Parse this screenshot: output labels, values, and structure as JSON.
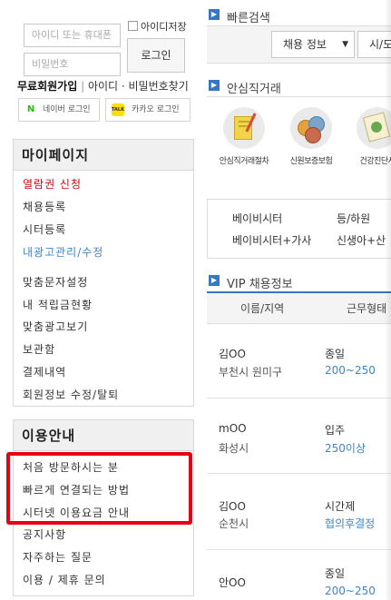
{
  "login": {
    "id_placeholder": "아이디 또는 휴대폰",
    "pw_placeholder": "비밀번호",
    "save_id_label": "아이디저장",
    "login_button": "로그인",
    "signup_link": "무료회원가입",
    "separator": "|",
    "find_link": "아이디 · 비밀번호찾기",
    "naver_label": "네이버 로그인",
    "kakao_label": "카카오 로그인",
    "naver_icon_text": "N",
    "kakao_icon_text": "TALK"
  },
  "mypage": {
    "title": "마이페이지",
    "items": [
      "열람권 신청",
      "채용등록",
      "시터등록",
      "내광고관리/수정",
      "맞춤문자설정",
      "내 적립금현황",
      "맞춤광고보기",
      "보관함",
      "결제내역",
      "회원정보 수정/탈퇴"
    ]
  },
  "guide": {
    "title": "이용안내",
    "items": [
      "처음 방문하시는 분",
      "빠르게 연결되는 방법",
      "시터넷 이용요금 안내",
      "공지사항",
      "자주하는 질문",
      "이용 / 제휴 문의"
    ]
  },
  "quick_search": {
    "title": "빠른검색",
    "select_job": "채용 정보",
    "select_arrow": "▼",
    "select_region": "시/도"
  },
  "safe_trade": {
    "title": "안심직거래",
    "items": [
      {
        "label": "안심직거래절차"
      },
      {
        "label": "신원보증보험"
      },
      {
        "label": "건강진단서"
      }
    ]
  },
  "services": [
    [
      "베이비시터",
      "등/하원"
    ],
    [
      "베이비시터+가사",
      "신생아+산"
    ]
  ],
  "vip": {
    "title": "VIP 채용정보",
    "headers": [
      "이름/지역",
      "근무형태"
    ],
    "rows": [
      {
        "name": "김OO",
        "region": "부천시 원미구",
        "type": "종일",
        "pay": "200~250"
      },
      {
        "name": "mOO",
        "region": "화성시",
        "type": "입주",
        "pay": "250이상"
      },
      {
        "name": "김OO",
        "region": "순천시",
        "type": "시간제",
        "pay": "협의후결정"
      },
      {
        "name": "안OO",
        "region": "",
        "type": "종일",
        "pay": "200~250"
      }
    ]
  },
  "colors": {
    "accent_blue": "#3577c5",
    "highlight_red": "#e60012",
    "link_red": "#d7000f",
    "link_blue": "#3c86c8"
  }
}
